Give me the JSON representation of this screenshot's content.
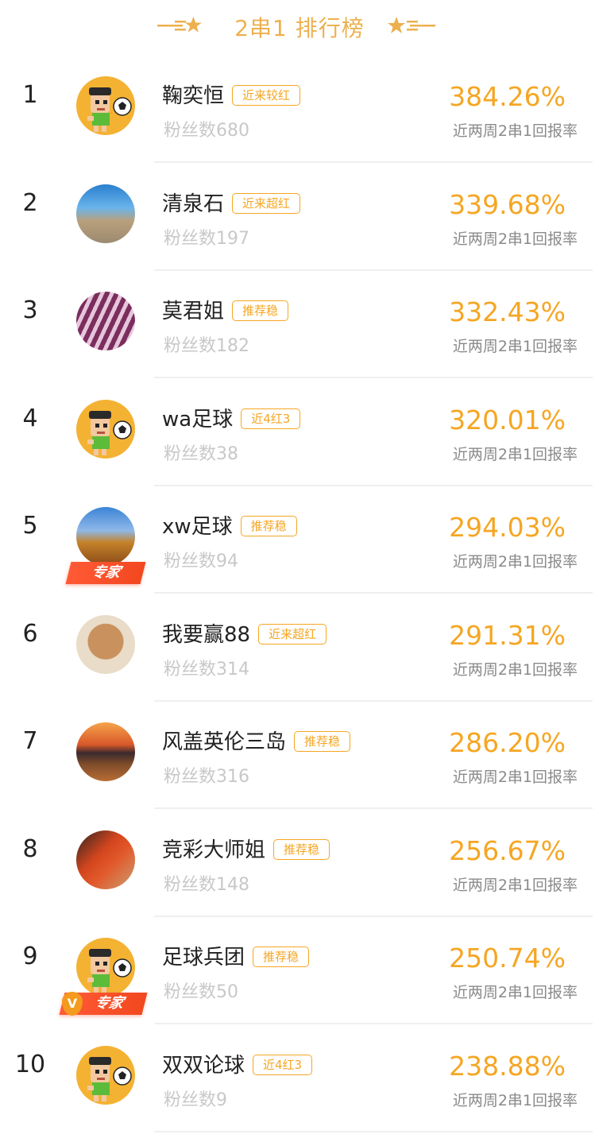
{
  "header": {
    "title": "2串1 排行榜"
  },
  "colors": {
    "accent": "#F5A623",
    "title": "#EDB04F",
    "expert": "#F2481F"
  },
  "rate_label": "近两周2串1回报率",
  "rows": [
    {
      "rank": "1",
      "name": "鞠奕恒",
      "tag": "近来较红",
      "fans": "粉丝数680",
      "rate": "384.26%",
      "avatar": "cartoon-soccer-avatar"
    },
    {
      "rank": "2",
      "name": "清泉石",
      "tag": "近来超红",
      "fans": "粉丝数197",
      "rate": "339.68%",
      "avatar": "stones-photo-avatar"
    },
    {
      "rank": "3",
      "name": "莫君姐",
      "tag": "推荐稳",
      "fans": "粉丝数182",
      "rate": "332.43%",
      "avatar": "dress-photo-avatar"
    },
    {
      "rank": "4",
      "name": "wa足球",
      "tag": "近4红3",
      "fans": "粉丝数38",
      "rate": "320.01%",
      "avatar": "cartoon-soccer-avatar"
    },
    {
      "rank": "5",
      "name": "xw足球",
      "tag": "推荐稳",
      "fans": "粉丝数94",
      "rate": "294.03%",
      "avatar": "palace-photo-avatar",
      "badge": "专家"
    },
    {
      "rank": "6",
      "name": "我要赢88",
      "tag": "近来超红",
      "fans": "粉丝数314",
      "rate": "291.31%",
      "avatar": "dog-photo-avatar"
    },
    {
      "rank": "7",
      "name": "风盖英伦三岛",
      "tag": "推荐稳",
      "fans": "粉丝数316",
      "rate": "286.20%",
      "avatar": "sunset-photo-avatar"
    },
    {
      "rank": "8",
      "name": "竞彩大师姐",
      "tag": "推荐稳",
      "fans": "粉丝数148",
      "rate": "256.67%",
      "avatar": "red-dress-photo-avatar"
    },
    {
      "rank": "9",
      "name": "足球兵团",
      "tag": "推荐稳",
      "fans": "粉丝数50",
      "rate": "250.74%",
      "avatar": "cartoon-soccer-avatar",
      "badge": "专家",
      "badge_v": "V"
    },
    {
      "rank": "10",
      "name": "双双论球",
      "tag": "近4红3",
      "fans": "粉丝数9",
      "rate": "238.88%",
      "avatar": "cartoon-soccer-avatar"
    }
  ]
}
